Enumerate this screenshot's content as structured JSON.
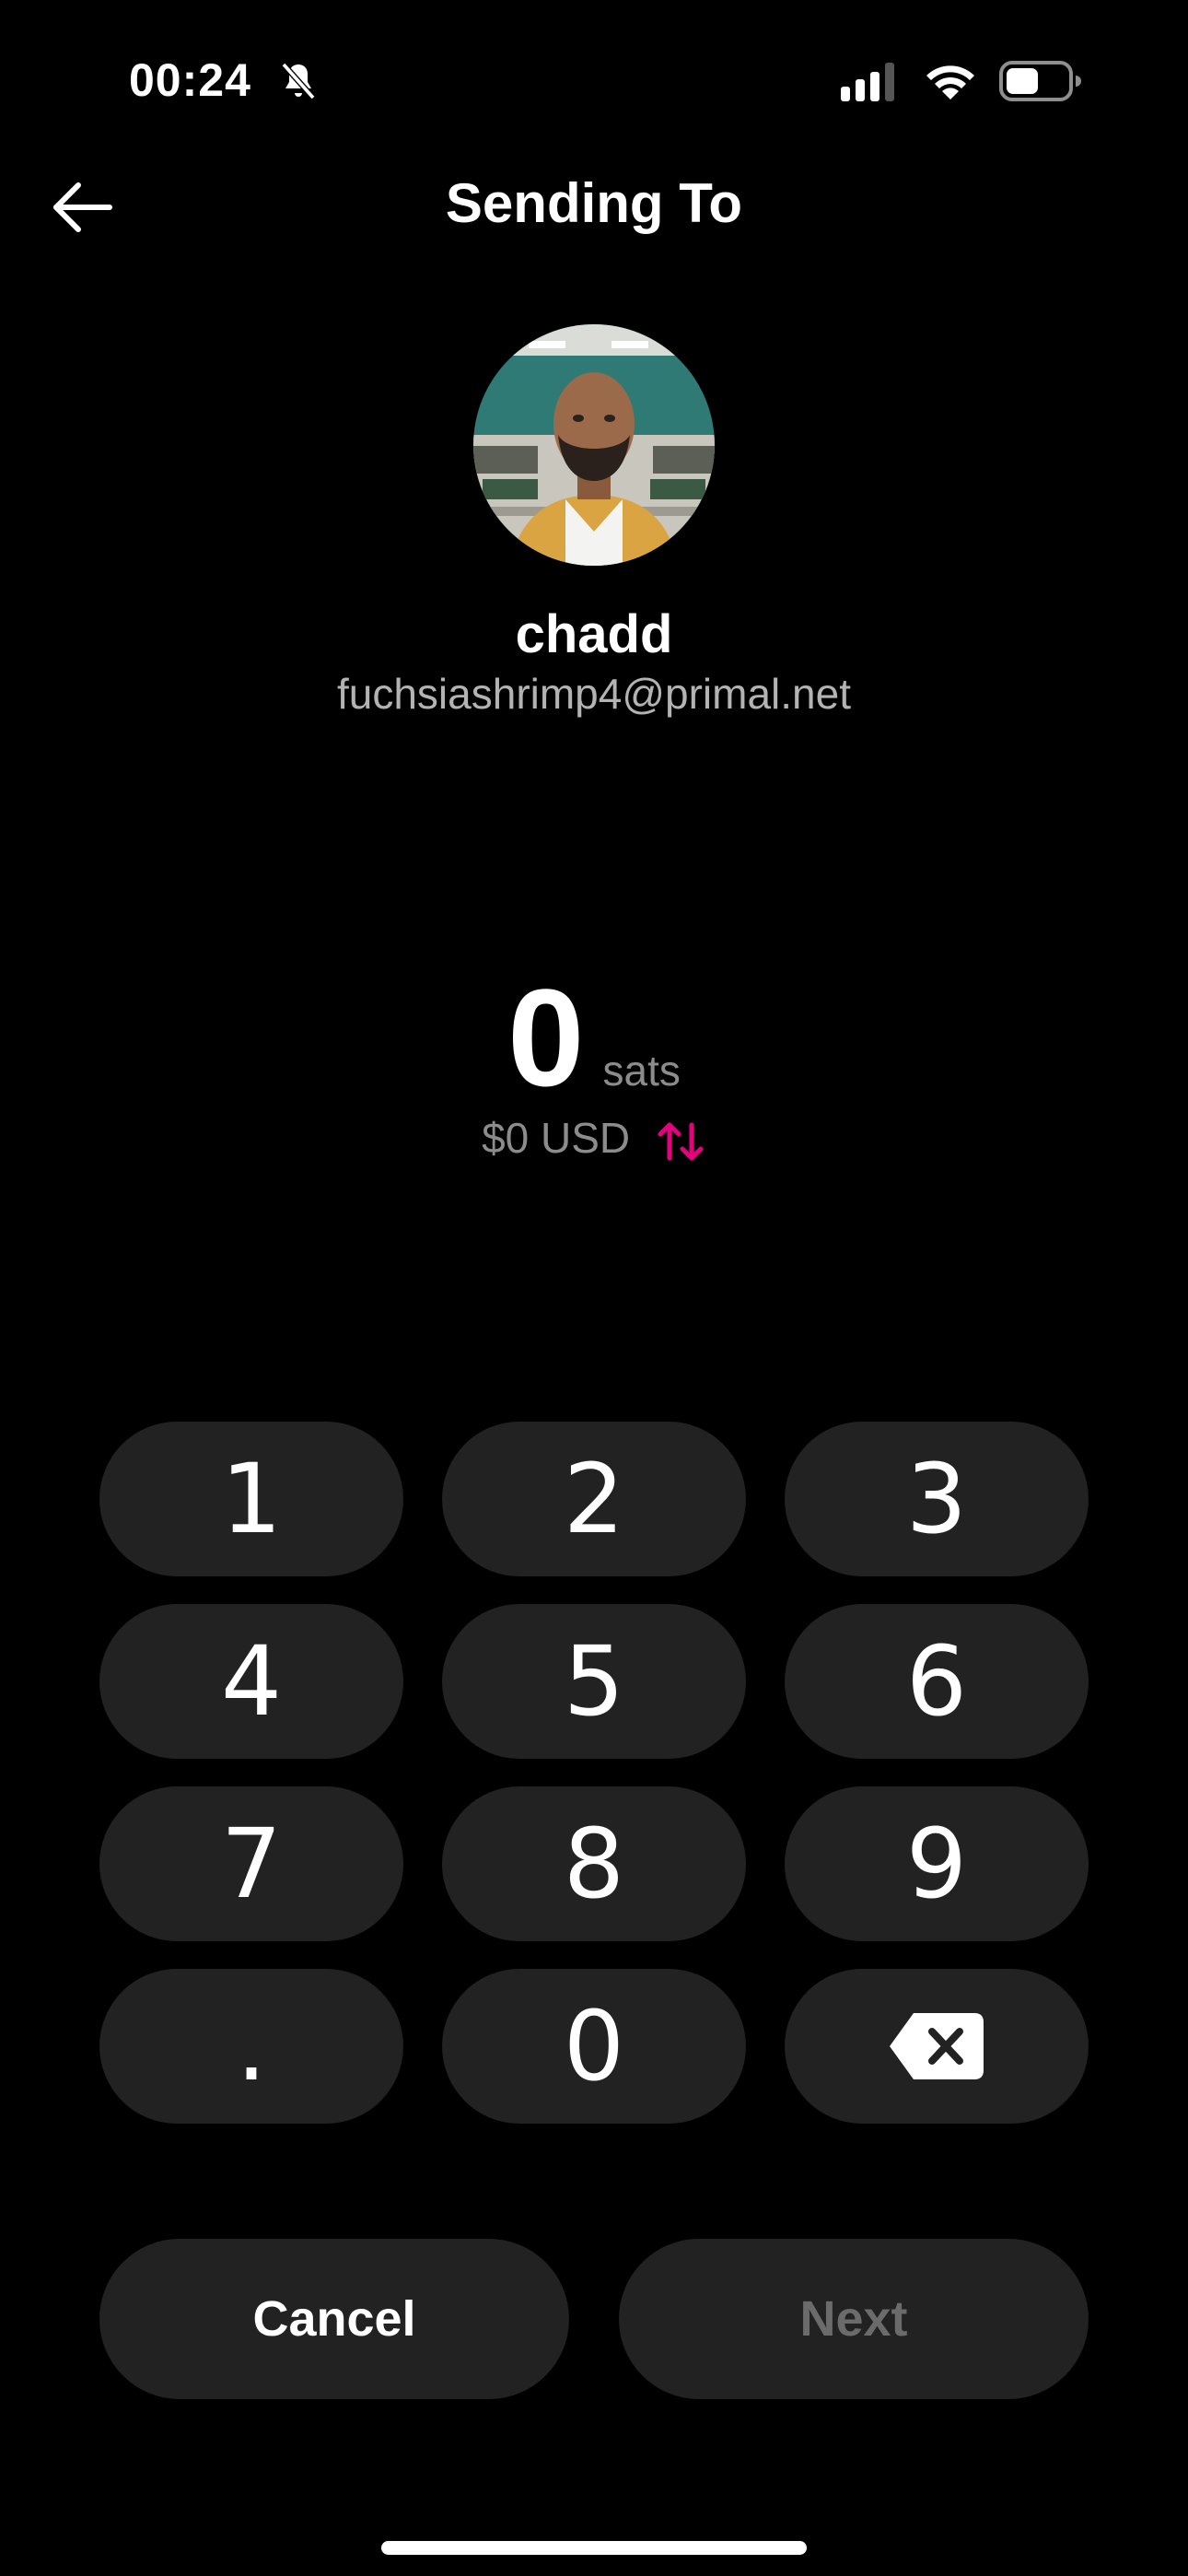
{
  "status_bar": {
    "time": "00:24",
    "icons": [
      "bell-slash-icon",
      "signal-icon",
      "wifi-icon",
      "battery-icon"
    ]
  },
  "header": {
    "title": "Sending To",
    "back_icon": "arrow-left-icon"
  },
  "recipient": {
    "name": "chadd",
    "address": "fuchsiashrimp4@primal.net"
  },
  "amount": {
    "value": "0",
    "unit": "sats",
    "fiat": "$0 USD",
    "swap_icon": "swap-arrows-icon",
    "swap_color": "#e6007e"
  },
  "keypad": {
    "keys": [
      "1",
      "2",
      "3",
      "4",
      "5",
      "6",
      "7",
      "8",
      "9",
      ".",
      "0"
    ],
    "backspace_icon": "backspace-icon"
  },
  "actions": {
    "cancel": "Cancel",
    "next": "Next"
  },
  "colors": {
    "background": "#000000",
    "key": "#222222",
    "muted": "#8c8c8c",
    "accent": "#e6007e"
  }
}
